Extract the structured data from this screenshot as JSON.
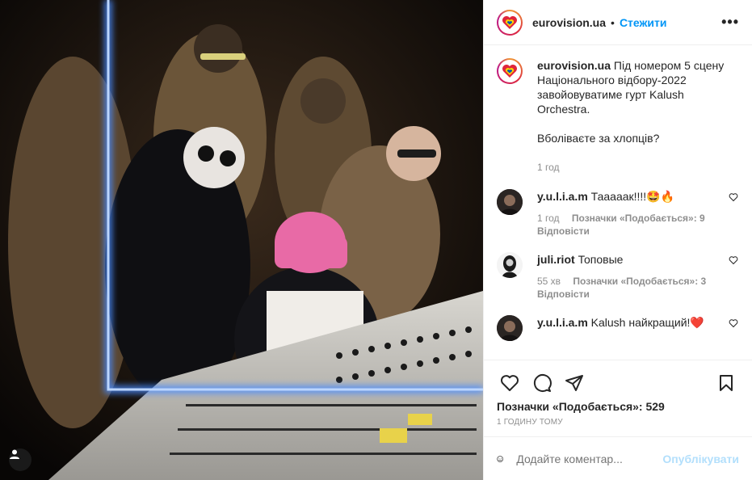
{
  "post": {
    "username": "eurovision.ua",
    "separator": "•",
    "follow_label": "Стежити",
    "more_label": "•••",
    "caption_user": "eurovision.ua",
    "caption_text": "Під номером 5 сцену Національного відбору-2022 завойовуватиме гурт Kalush Orchestra.",
    "caption_text2": "Вболіваєте за хлопців?",
    "caption_time": "1 год"
  },
  "comments": [
    {
      "user": "y.u.l.i.a.m",
      "text": "Тааааак!!!!🤩🔥",
      "time": "1 год",
      "likes": "Позначки «Подобається»: 9",
      "reply": "Відповісти"
    },
    {
      "user": "juli.riot",
      "text": "Топовые",
      "time": "55 хв",
      "likes": "Позначки «Подобається»: 3",
      "reply": "Відповісти"
    },
    {
      "user": "y.u.l.i.a.m",
      "text": "Kalush найкращий!❤️"
    }
  ],
  "footer": {
    "likes_count": "Позначки «Подобається»: 529",
    "time_ago": "1 годину тому",
    "comment_placeholder": "Додайте коментар...",
    "post_button": "Опублікувати"
  },
  "colors": {
    "link_blue": "#0095f6",
    "post_disabled": "#b2dffc",
    "meta_gray": "#8e8e8e",
    "frame_glow": "#4a8cff",
    "bucket_hat_pink": "#e86aa6"
  },
  "icons": {
    "like": "heart-icon",
    "comment": "comment-bubble-icon",
    "share": "paper-plane-icon",
    "save": "bookmark-icon",
    "emoji": "smiley-icon",
    "tag": "user-tag-icon"
  }
}
